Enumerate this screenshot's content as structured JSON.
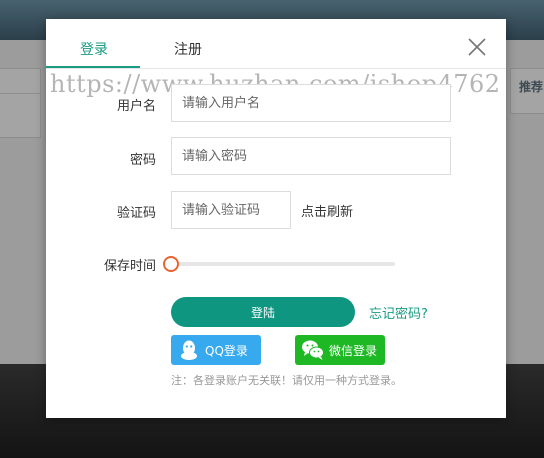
{
  "background": {
    "right_tab_label": "推荐"
  },
  "watermark": "https://www.huzhan.com/ishop4762",
  "modal": {
    "tabs": [
      {
        "label": "登录",
        "active": true
      },
      {
        "label": "注册",
        "active": false
      }
    ],
    "close_icon": "close-icon"
  },
  "form": {
    "username": {
      "label": "用户名",
      "placeholder": "请输入用户名",
      "value": ""
    },
    "password": {
      "label": "密码",
      "placeholder": "请输入密码",
      "value": ""
    },
    "captcha": {
      "label": "验证码",
      "placeholder": "请输入验证码",
      "value": "",
      "refresh_label": "点击刷新"
    },
    "keep_time": {
      "label": "保存时间",
      "value": 0
    }
  },
  "actions": {
    "login_label": "登陆",
    "forgot_label": "忘记密码?",
    "qq_label": "QQ登录",
    "wechat_label": "微信登录"
  },
  "note": "注：各登录账户无关联！请仅用一种方式登录。",
  "colors": {
    "accent": "#1a9b83",
    "login_button": "#0f9681",
    "qq": "#36a9ef",
    "wechat": "#1db823",
    "slider_handle": "#e86433"
  }
}
